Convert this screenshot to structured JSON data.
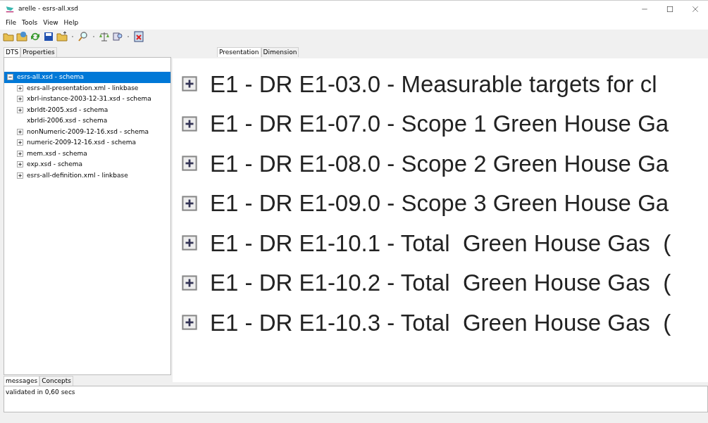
{
  "window": {
    "title": "arelle - esrs-all.xsd"
  },
  "menu": [
    "File",
    "Tools",
    "View",
    "Help"
  ],
  "left_tabs": [
    {
      "label": "DTS",
      "selected": true
    },
    {
      "label": "Properties",
      "selected": false
    }
  ],
  "tree": [
    {
      "label": "esrs-all.xsd - schema",
      "selected": true,
      "kind": "expanded",
      "children": [
        {
          "label": "esrs-all-presentation.xml - linkbase",
          "selected": false,
          "kind": "collapsed"
        },
        {
          "label": "xbrl-instance-2003-12-31.xsd - schema",
          "selected": false,
          "kind": "collapsed"
        },
        {
          "label": "xbrldt-2005.xsd - schema",
          "selected": false,
          "kind": "collapsed"
        },
        {
          "label": "xbrldi-2006.xsd - schema",
          "selected": false,
          "kind": "leaf"
        },
        {
          "label": "nonNumeric-2009-12-16.xsd - schema",
          "selected": false,
          "kind": "collapsed"
        },
        {
          "label": "numeric-2009-12-16.xsd - schema",
          "selected": false,
          "kind": "collapsed"
        },
        {
          "label": "mem.xsd - schema",
          "selected": false,
          "kind": "collapsed"
        },
        {
          "label": "exp.xsd - schema",
          "selected": false,
          "kind": "collapsed"
        },
        {
          "label": "esrs-all-definition.xml - linkbase",
          "selected": false,
          "kind": "collapsed"
        }
      ]
    }
  ],
  "right_tabs": [
    {
      "label": "Presentation",
      "selected": true
    },
    {
      "label": "Dimension",
      "selected": false
    }
  ],
  "magnified_rows": [
    {
      "label": "E1 - DR E1-03.0 - Measurable targets for cl",
      "expanded": false
    },
    {
      "label": "E1 - DR E1-07.0 - Scope 1 Green House Ga",
      "expanded": false
    },
    {
      "label": "E1 - DR E1-08.0 - Scope 2 Green House Ga",
      "expanded": false
    },
    {
      "label": "E1 - DR E1-09.0 - Scope 3 Green House Ga",
      "expanded": false
    },
    {
      "label": "E1 - DR E1-10.1 - Total  Green House Gas  (",
      "expanded": false
    },
    {
      "label": "E1 - DR E1-10.2 - Total  Green House Gas  (",
      "expanded": false
    },
    {
      "label": "E1 - DR E1-10.3 - Total  Green House Gas  (",
      "expanded": false
    }
  ],
  "bottom_tabs": [
    {
      "label": "messages",
      "selected": true
    },
    {
      "label": "Concepts",
      "selected": false
    }
  ],
  "messages": [
    "validated in 0,60 secs"
  ]
}
